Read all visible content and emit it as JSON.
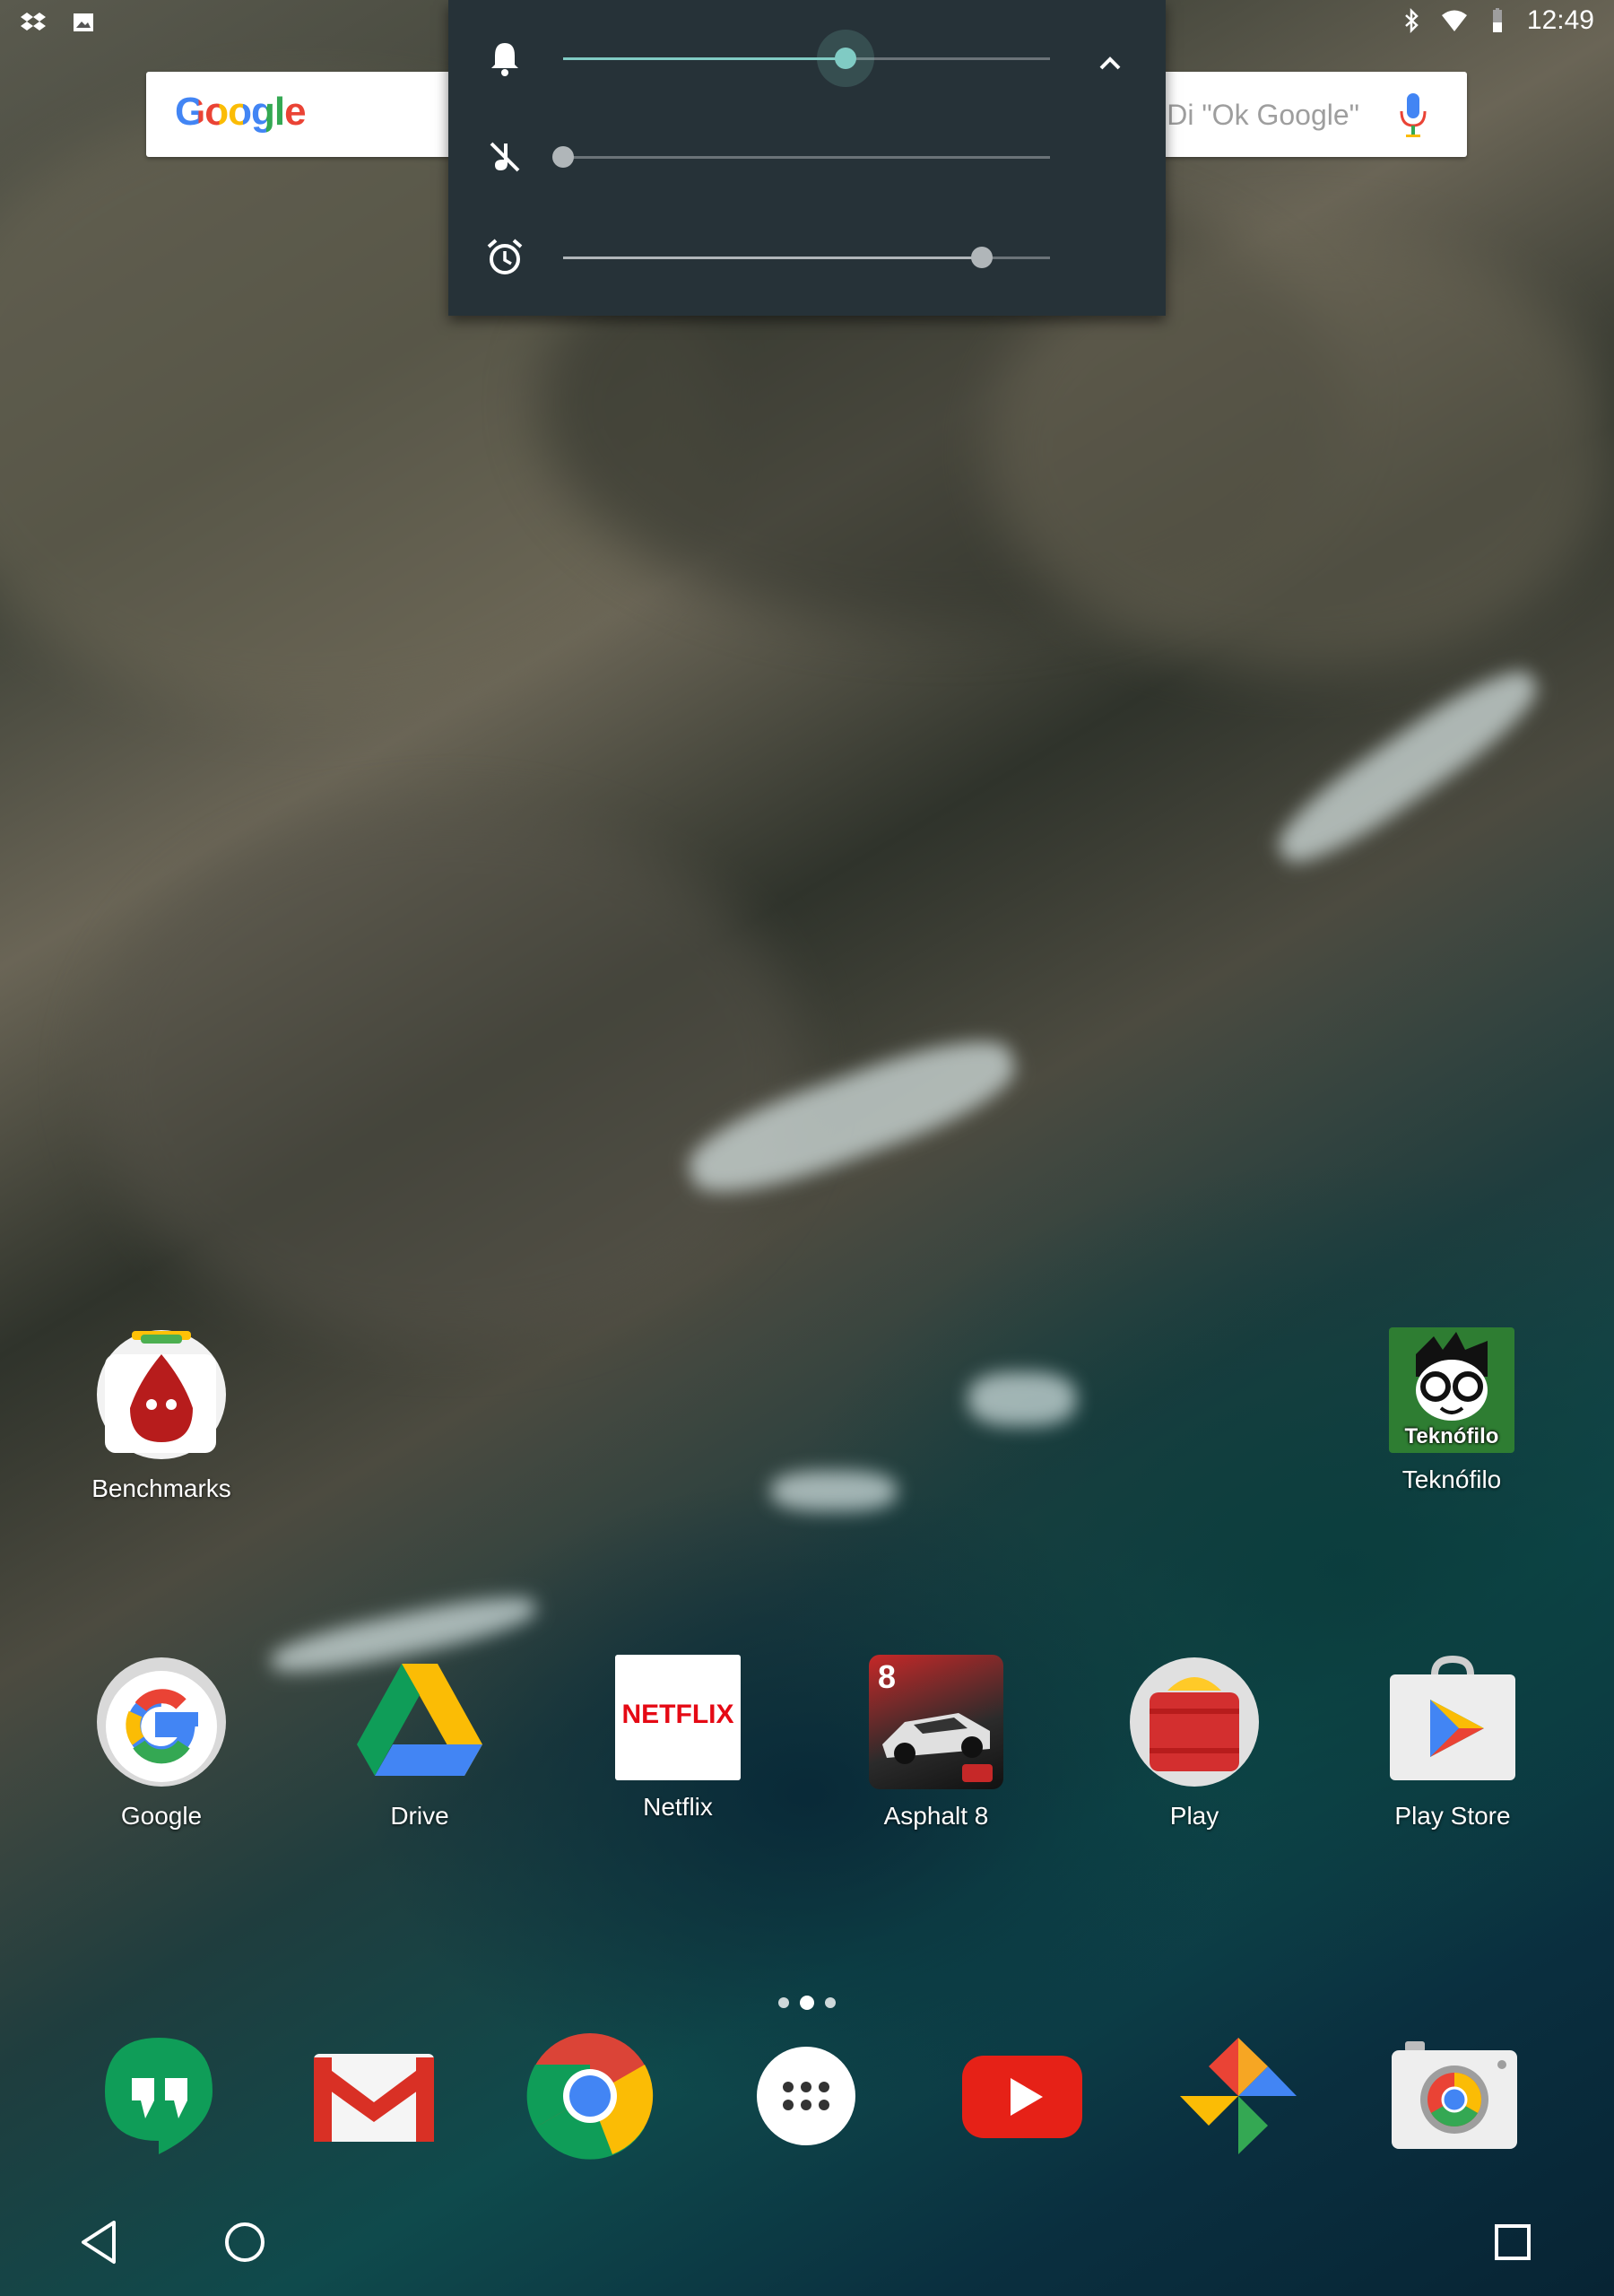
{
  "status_bar": {
    "time": "12:49",
    "left_icons": [
      "dropbox-icon",
      "image-icon"
    ],
    "right_icons": [
      "bluetooth-icon",
      "wifi-icon",
      "battery-icon"
    ]
  },
  "search_widget": {
    "logo": "Google",
    "hint": "Di \"Ok Google\"",
    "icon": "mic-icon"
  },
  "volume_panel": {
    "ringer": {
      "icon": "bell-icon",
      "level": 0.58
    },
    "media": {
      "icon": "media-muted-icon",
      "level": 0.0
    },
    "alarm": {
      "icon": "alarm-icon",
      "level": 0.86
    },
    "expand_icon": "chevron-up-icon"
  },
  "desktop": {
    "benchmarks": {
      "label": "Benchmarks"
    },
    "teknofilo": {
      "label": "Teknófilo",
      "badge": "Teknófilo"
    }
  },
  "apps_row": [
    {
      "label": "Google"
    },
    {
      "label": "Drive"
    },
    {
      "label": "Netflix",
      "logo": "NETFLIX"
    },
    {
      "label": "Asphalt 8",
      "badge": "8"
    },
    {
      "label": "Play"
    },
    {
      "label": "Play Store"
    }
  ],
  "dock": [
    "hangouts-icon",
    "gmail-icon",
    "chrome-icon",
    "app-drawer-icon",
    "youtube-icon",
    "photos-icon",
    "camera-icon"
  ],
  "pager": {
    "pages": 3,
    "current": 2
  },
  "nav": [
    "back-icon",
    "home-icon",
    "recents-icon"
  ],
  "colors": {
    "accent": "#80cbc4",
    "panel": "#263238"
  }
}
